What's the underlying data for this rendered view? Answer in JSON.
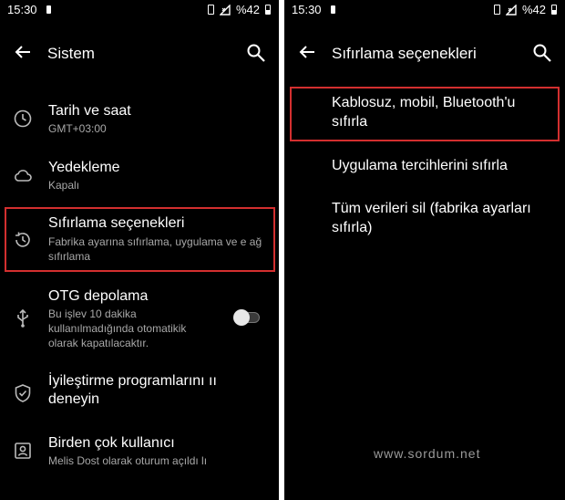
{
  "status_bar": {
    "time": "15:30",
    "battery": "%42"
  },
  "left": {
    "title": "Sistem",
    "items": [
      {
        "title": "Tarih ve saat",
        "subtitle": "GMT+03:00"
      },
      {
        "title": "Yedekleme",
        "subtitle": "Kapalı"
      },
      {
        "title": "Sıfırlama seçenekleri",
        "subtitle": "Fabrika ayarına sıfırlama, uygulama ve e ağ sıfırlama"
      },
      {
        "title": "OTG depolama",
        "subtitle": "Bu işlev 10 dakika kullanılmadığında otomatikik olarak kapatılacaktır."
      },
      {
        "title": "İyileştirme programlarını ıı deneyin",
        "subtitle": ""
      },
      {
        "title": "Birden çok kullanıcı",
        "subtitle": "Melis Dost olarak oturum açıldı lı"
      }
    ],
    "otg_toggle_on": false
  },
  "right": {
    "title": "Sıfırlama seçenekleri",
    "options": [
      "Kablosuz, mobil, Bluetooth'u sıfırla",
      "Uygulama tercihlerini sıfırla",
      "Tüm verileri sil (fabrika ayarları sıfırla)"
    ],
    "watermark": "www.sordum.net"
  },
  "colors": {
    "background": "#000000",
    "highlight": "#d32f2f",
    "secondary_text": "#a8a8a8"
  },
  "icons": [
    "back-arrow-icon",
    "search-icon",
    "clock-icon",
    "cloud-icon",
    "restore-history-icon",
    "usb-icon",
    "shield-check-icon",
    "user-account-icon"
  ]
}
